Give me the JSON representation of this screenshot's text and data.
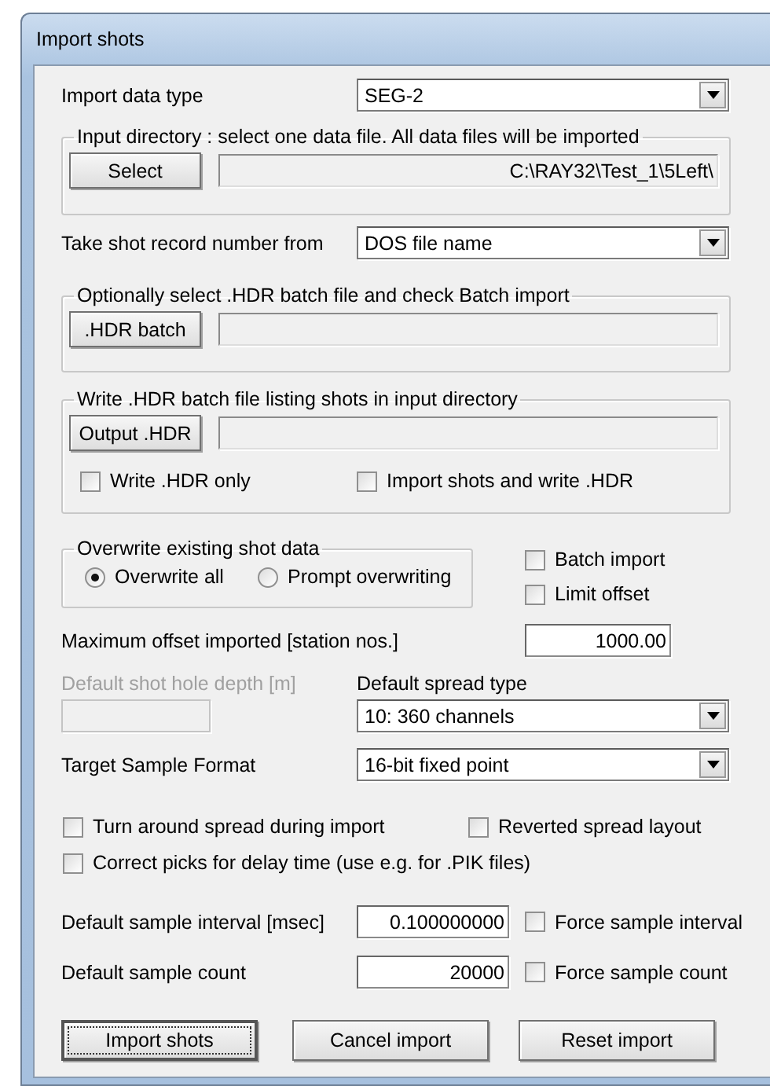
{
  "window": {
    "title": "Import shots"
  },
  "import_data_type": {
    "label": "Import data type",
    "value": "SEG-2"
  },
  "input_directory": {
    "legend": "Input directory : select one data file. All data files will be imported",
    "button": "Select",
    "path": "C:\\RAY32\\Test_1\\5Left\\"
  },
  "shot_number_source": {
    "label": "Take shot record number from",
    "value": "DOS file name"
  },
  "hdr_batch": {
    "legend": "Optionally select .HDR batch file and check Batch import",
    "button": ".HDR batch"
  },
  "write_hdr": {
    "legend": "Write .HDR batch file listing shots in input directory",
    "button": "Output .HDR",
    "options": [
      {
        "label": "Write .HDR only",
        "checked": false
      },
      {
        "label": "Import shots and write .HDR",
        "checked": false
      }
    ]
  },
  "overwrite": {
    "legend": "Overwrite existing shot data",
    "options": [
      {
        "label": "Overwrite all",
        "selected": true
      },
      {
        "label": "Prompt overwriting",
        "selected": false
      }
    ]
  },
  "side_options": [
    {
      "label": "Batch import",
      "checked": false
    },
    {
      "label": "Limit offset",
      "checked": false
    }
  ],
  "max_offset": {
    "label": "Maximum offset imported [station nos.]",
    "value": "1000.00"
  },
  "shot_hole_depth": {
    "label": "Default shot hole depth [m]",
    "disabled": true
  },
  "spread_type": {
    "label": "Default spread type",
    "value": "10: 360 channels"
  },
  "sample_format": {
    "label": "Target Sample Format",
    "value": "16-bit fixed point"
  },
  "spread_options": [
    {
      "label": "Turn around spread during import",
      "checked": false
    },
    {
      "label": "Reverted spread layout",
      "checked": false
    },
    {
      "label": "Correct picks for delay time (use e.g. for .PIK files)",
      "checked": false
    }
  ],
  "sample_interval": {
    "label": "Default sample interval [msec]",
    "value": "0.100000000",
    "force": {
      "label": "Force sample interval",
      "checked": false
    }
  },
  "sample_count": {
    "label": "Default sample count",
    "value": "20000",
    "force": {
      "label": "Force sample count",
      "checked": false
    }
  },
  "buttons": [
    {
      "label": "Import shots",
      "focused": true
    },
    {
      "label": "Cancel import",
      "focused": false
    },
    {
      "label": "Reset import",
      "focused": false
    }
  ]
}
